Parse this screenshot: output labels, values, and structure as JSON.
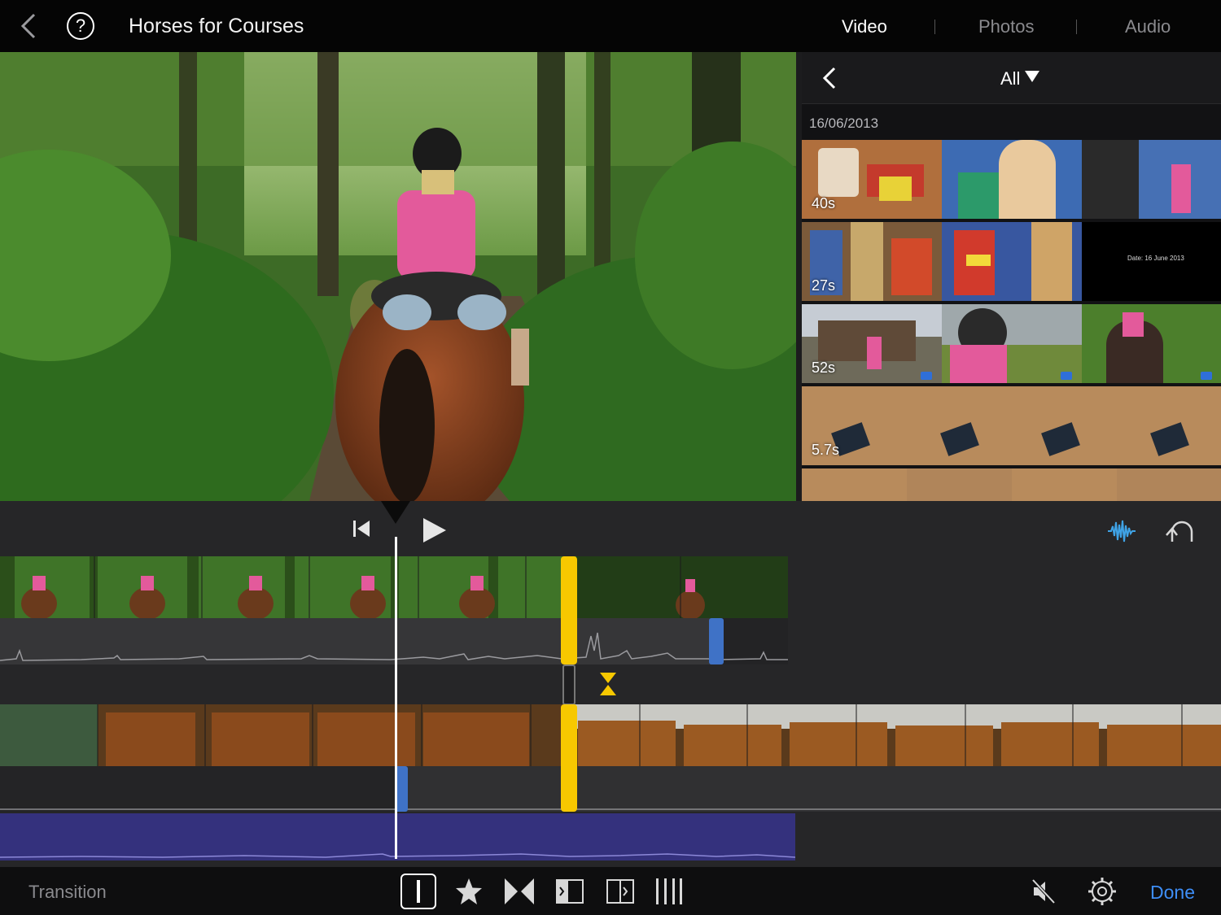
{
  "header": {
    "title": "Horses for Courses",
    "tabs": [
      {
        "label": "Video",
        "active": true
      },
      {
        "label": "Photos",
        "active": false
      },
      {
        "label": "Audio",
        "active": false
      }
    ]
  },
  "browser": {
    "filter_label": "All",
    "date": "16/06/2013",
    "clips": [
      {
        "duration": "40s"
      },
      {
        "duration": "27s",
        "title_card": "Date: 16 June 2013"
      },
      {
        "duration": "52s"
      },
      {
        "duration": "5.7s"
      }
    ]
  },
  "toolbar": {
    "transition_label": "Transition",
    "done_label": "Done"
  },
  "colors": {
    "accent": "#3e8ef7",
    "trim_handle": "#f7c800",
    "clip_handle": "#3f72c6",
    "music_track": "#34317d",
    "waveform_icon": "#3fa3e6"
  },
  "icons": [
    "back-icon",
    "help-icon",
    "chevron-left-icon",
    "caret-down-icon",
    "skip-back-icon",
    "play-icon",
    "waveform-icon",
    "undo-icon",
    "mute-icon",
    "gear-icon"
  ]
}
